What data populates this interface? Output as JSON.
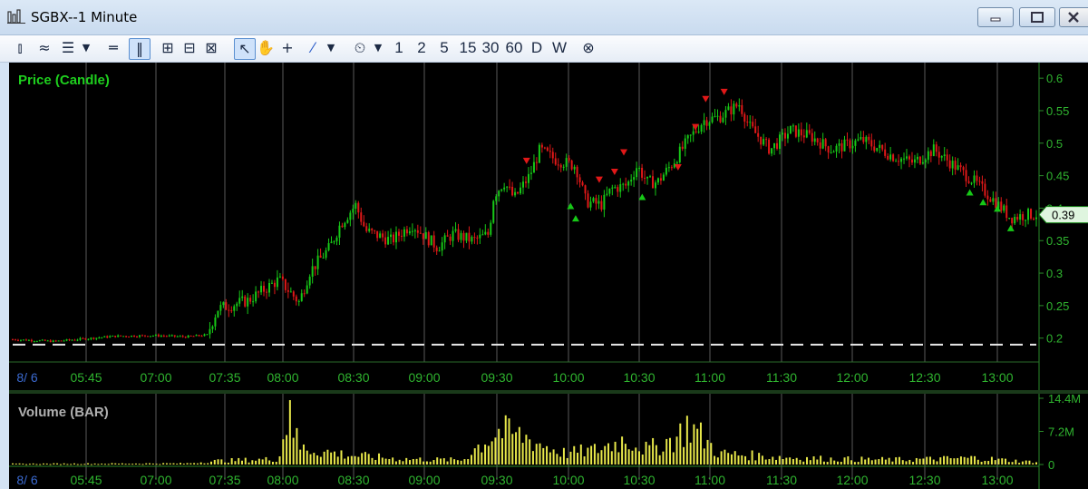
{
  "window": {
    "title": "SGBX--1 Minute"
  },
  "toolbar": {
    "timeframes": [
      "1",
      "2",
      "5",
      "15",
      "30",
      "60",
      "D",
      "W"
    ]
  },
  "colors": {
    "up": "#17c817",
    "down": "#e01818",
    "volume": "#e8e84a",
    "grid": "#5a5a5a",
    "axis_text": "#2fb42f",
    "background": "#000000"
  },
  "chart_data": [
    {
      "type": "candlestick",
      "title": "Price (Candle)",
      "ylim": [
        0.18,
        0.61
      ],
      "yticks": [
        "0.6",
        "0.55",
        "0.5",
        "0.45",
        "0.4",
        "0.35",
        "0.3",
        "0.25",
        "0.2"
      ],
      "xticks": [
        "8/ 6",
        "05:45",
        "07:00",
        "07:35",
        "08:00",
        "08:30",
        "09:00",
        "09:30",
        "10:00",
        "10:30",
        "11:00",
        "11:30",
        "12:00",
        "12:30",
        "13:00"
      ],
      "last_price_label": "0.39",
      "reference_line": 0.19,
      "path": [
        [
          0.0,
          0.198
        ],
        [
          0.04,
          0.195
        ],
        [
          0.1,
          0.203
        ],
        [
          0.14,
          0.204
        ],
        [
          0.17,
          0.202
        ],
        [
          0.19,
          0.205
        ],
        [
          0.2,
          0.245
        ],
        [
          0.23,
          0.258
        ],
        [
          0.26,
          0.29
        ],
        [
          0.28,
          0.255
        ],
        [
          0.29,
          0.302
        ],
        [
          0.31,
          0.34
        ],
        [
          0.32,
          0.375
        ],
        [
          0.335,
          0.405
        ],
        [
          0.345,
          0.365
        ],
        [
          0.37,
          0.35
        ],
        [
          0.39,
          0.375
        ],
        [
          0.415,
          0.34
        ],
        [
          0.43,
          0.36
        ],
        [
          0.45,
          0.35
        ],
        [
          0.465,
          0.36
        ],
        [
          0.47,
          0.42
        ],
        [
          0.48,
          0.44
        ],
        [
          0.49,
          0.415
        ],
        [
          0.505,
          0.45
        ],
        [
          0.515,
          0.49
        ],
        [
          0.53,
          0.475
        ],
        [
          0.55,
          0.465
        ],
        [
          0.56,
          0.41
        ],
        [
          0.575,
          0.405
        ],
        [
          0.585,
          0.43
        ],
        [
          0.6,
          0.435
        ],
        [
          0.61,
          0.465
        ],
        [
          0.62,
          0.44
        ],
        [
          0.63,
          0.44
        ],
        [
          0.645,
          0.47
        ],
        [
          0.66,
          0.505
        ],
        [
          0.675,
          0.535
        ],
        [
          0.69,
          0.54
        ],
        [
          0.71,
          0.56
        ],
        [
          0.72,
          0.525
        ],
        [
          0.74,
          0.49
        ],
        [
          0.76,
          0.52
        ],
        [
          0.78,
          0.51
        ],
        [
          0.8,
          0.49
        ],
        [
          0.83,
          0.505
        ],
        [
          0.86,
          0.48
        ],
        [
          0.88,
          0.47
        ],
        [
          0.9,
          0.49
        ],
        [
          0.92,
          0.465
        ],
        [
          0.94,
          0.44
        ],
        [
          0.96,
          0.41
        ],
        [
          0.975,
          0.385
        ],
        [
          0.99,
          0.39
        ]
      ],
      "sell_markers": [
        [
          0.502,
          0.472
        ],
        [
          0.573,
          0.443
        ],
        [
          0.588,
          0.455
        ],
        [
          0.597,
          0.485
        ],
        [
          0.65,
          0.462
        ],
        [
          0.667,
          0.524
        ],
        [
          0.677,
          0.567
        ],
        [
          0.695,
          0.578
        ]
      ],
      "buy_markers": [
        [
          0.545,
          0.404
        ],
        [
          0.55,
          0.385
        ],
        [
          0.615,
          0.418
        ],
        [
          0.935,
          0.425
        ],
        [
          0.948,
          0.41
        ],
        [
          0.962,
          0.4
        ],
        [
          0.975,
          0.37
        ]
      ]
    },
    {
      "type": "bar",
      "title": "Volume (BAR)",
      "ylim": [
        0,
        14.4
      ],
      "yticks": [
        "14.4M",
        "7.2M",
        "0"
      ],
      "xticks": [
        "8/ 6",
        "05:45",
        "07:00",
        "07:35",
        "08:00",
        "08:30",
        "09:00",
        "09:30",
        "10:00",
        "10:30",
        "11:00",
        "11:30",
        "12:00",
        "12:30",
        "13:00"
      ],
      "profile": [
        [
          0.0,
          0.2
        ],
        [
          0.17,
          0.3
        ],
        [
          0.2,
          1.0
        ],
        [
          0.26,
          1.5
        ],
        [
          0.27,
          14.0
        ],
        [
          0.28,
          4.5
        ],
        [
          0.33,
          2.5
        ],
        [
          0.38,
          1.5
        ],
        [
          0.44,
          1.2
        ],
        [
          0.45,
          4.0
        ],
        [
          0.475,
          9.0
        ],
        [
          0.5,
          7.5
        ],
        [
          0.52,
          5.0
        ],
        [
          0.54,
          3.0
        ],
        [
          0.57,
          4.0
        ],
        [
          0.6,
          7.0
        ],
        [
          0.62,
          4.0
        ],
        [
          0.65,
          7.5
        ],
        [
          0.66,
          11.0
        ],
        [
          0.69,
          3.0
        ],
        [
          0.75,
          2.0
        ],
        [
          0.8,
          1.5
        ],
        [
          0.86,
          1.3
        ],
        [
          0.9,
          1.5
        ],
        [
          0.94,
          1.8
        ],
        [
          0.99,
          0.8
        ]
      ]
    }
  ]
}
